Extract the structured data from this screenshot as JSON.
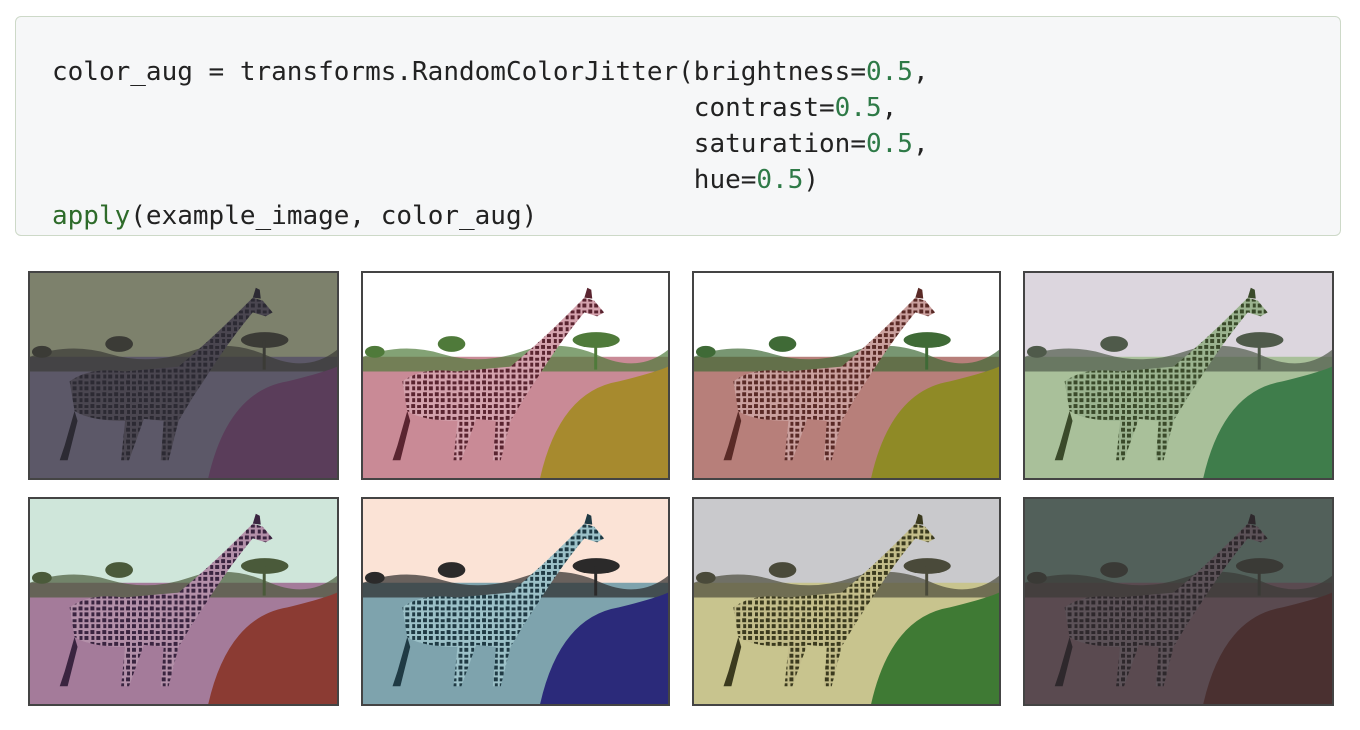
{
  "code": {
    "lines": [
      [
        {
          "t": "color_aug = transforms.RandomColorJitter(brightness=",
          "k": "plain"
        },
        {
          "t": "0.5",
          "k": "num"
        },
        {
          "t": ",",
          "k": "plain"
        }
      ],
      [
        {
          "t": "                                         contrast=",
          "k": "plain"
        },
        {
          "t": "0.5",
          "k": "num"
        },
        {
          "t": ",",
          "k": "plain"
        }
      ],
      [
        {
          "t": "                                         saturation=",
          "k": "plain"
        },
        {
          "t": "0.5",
          "k": "num"
        },
        {
          "t": ",",
          "k": "plain"
        }
      ],
      [
        {
          "t": "                                         hue=",
          "k": "plain"
        },
        {
          "t": "0.5",
          "k": "num"
        },
        {
          "t": ")",
          "k": "plain"
        }
      ],
      [
        {
          "t": "apply",
          "k": "fn"
        },
        {
          "t": "(example_image, color_aug)",
          "k": "plain"
        }
      ]
    ]
  },
  "output": {
    "image_count": 8,
    "subject": "giraffe",
    "tiles": [
      {
        "name": "augmented-image-1",
        "sky": "#7d816c",
        "ground": "#5c5868",
        "bush": "#5a3d5a",
        "body": "#4a4650",
        "spots": "#2c2a33",
        "tree": "#3b3b36"
      },
      {
        "name": "augmented-image-2",
        "sky": "#ffffff",
        "ground": "#c98a96",
        "bush": "#a78a2e",
        "body": "#d4a2ad",
        "spots": "#5a2430",
        "tree": "#4f7a3a"
      },
      {
        "name": "augmented-image-3",
        "sky": "#ffffff",
        "ground": "#b77f7a",
        "bush": "#8f8a26",
        "body": "#caa09e",
        "spots": "#5a2a26",
        "tree": "#3f6a36"
      },
      {
        "name": "augmented-image-4",
        "sky": "#dcd6de",
        "ground": "#a9c09a",
        "bush": "#3f7d4b",
        "body": "#9bb38f",
        "spots": "#3a4a2a",
        "tree": "#4f5a4a"
      },
      {
        "name": "augmented-image-5",
        "sky": "#cfe6da",
        "ground": "#a47b9a",
        "bush": "#8b3b33",
        "body": "#b390a9",
        "spots": "#3a2440",
        "tree": "#4a5a3a"
      },
      {
        "name": "augmented-image-6",
        "sky": "#fbe3d6",
        "ground": "#7ea3ad",
        "bush": "#2b2a7a",
        "body": "#9cc1c8",
        "spots": "#1f3a44",
        "tree": "#2b2a2a"
      },
      {
        "name": "augmented-image-7",
        "sky": "#c9c9cc",
        "ground": "#c8c48e",
        "bush": "#3f7a34",
        "body": "#c3bd8a",
        "spots": "#3b3a1e",
        "tree": "#4a4a3a"
      },
      {
        "name": "augmented-image-8",
        "sky": "#52605a",
        "ground": "#5a4a50",
        "bush": "#4a3030",
        "body": "#5c5258",
        "spots": "#2e282c",
        "tree": "#3a3a36"
      }
    ]
  }
}
